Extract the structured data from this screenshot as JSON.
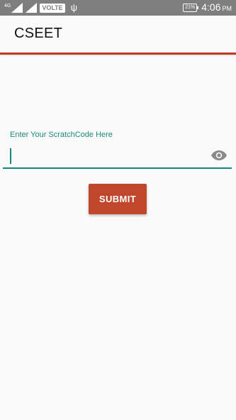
{
  "status_bar": {
    "network": "4G",
    "volte": "VOLTE",
    "battery": "21%",
    "time": "4:06",
    "ampm": "PM"
  },
  "app_bar": {
    "title": "CSEET"
  },
  "form": {
    "label": "Enter Your ScratchCode Here",
    "input_value": "",
    "submit_label": "SUBMIT"
  },
  "colors": {
    "accent": "#13887a",
    "primary": "#c0472b",
    "status_bar": "#7e7e7e"
  },
  "icons": [
    "signal-icon",
    "usb-icon",
    "battery-icon",
    "eye-icon"
  ]
}
